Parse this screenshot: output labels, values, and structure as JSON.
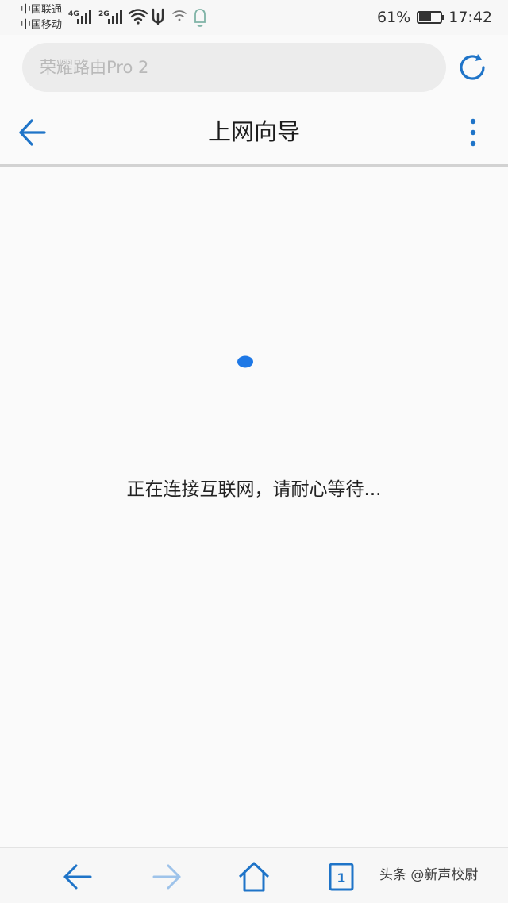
{
  "status_bar": {
    "carrier_1": "中国联通",
    "carrier_2": "中国移动",
    "signal_1_tech": "4G",
    "signal_2_tech": "2G",
    "battery_percent": "61%",
    "battery_level": 0.61,
    "time": "17:42"
  },
  "address_bar": {
    "text": "荣耀路由Pro 2"
  },
  "header": {
    "title": "上网向导"
  },
  "main": {
    "loading_message": "正在连接互联网，请耐心等待..."
  },
  "bottom_toolbar": {
    "tab_count": "1",
    "watermark": "头条 @新声校尉"
  },
  "colors": {
    "accent": "#1f74c8",
    "spinner": "#1e78e6",
    "background": "#fafafa"
  }
}
